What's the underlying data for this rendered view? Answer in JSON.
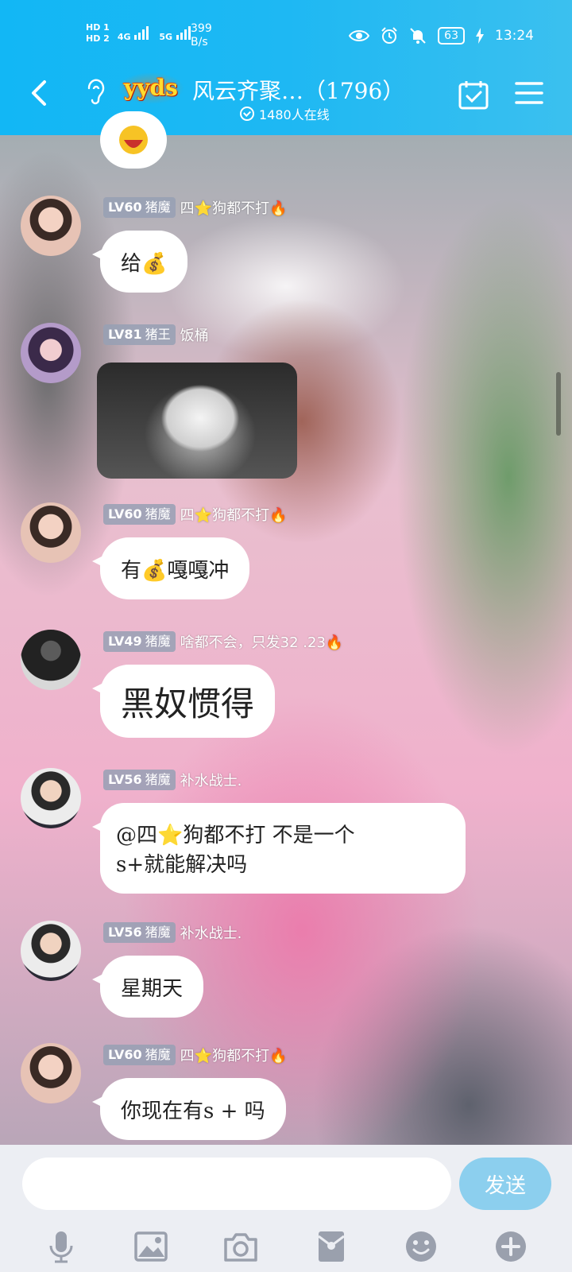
{
  "status_bar": {
    "sim1": "HD 1",
    "sim2": "HD 2",
    "net1": "4G",
    "net2": "5G",
    "speed_value": "399",
    "speed_unit": "B/s",
    "battery": "63",
    "time": "13:24"
  },
  "header": {
    "yyds_logo_text": "yyds",
    "group_name": "风云齐聚…（1796）",
    "online_count": "1480人在线"
  },
  "messages": [
    {
      "level": "LV60",
      "role": "猪魔",
      "nickname": "四⭐狗都不打🔥",
      "text": "给💰"
    },
    {
      "level": "LV81",
      "role": "猪王",
      "nickname": "饭桶",
      "image": "cat-photo"
    },
    {
      "level": "LV60",
      "role": "猪魔",
      "nickname": "四⭐狗都不打🔥",
      "text": "有💰嘎嘎冲"
    },
    {
      "level": "LV49",
      "role": "猪魔",
      "nickname": "啥都不会，只发32 .23🔥",
      "text": "黑奴惯得"
    },
    {
      "level": "LV56",
      "role": "猪魔",
      "nickname": "补水战士.",
      "text_line1": "@四⭐狗都不打 不是一个",
      "text_line2": "s+就能解决吗"
    },
    {
      "level": "LV56",
      "role": "猪魔",
      "nickname": "补水战士.",
      "text": "星期天"
    },
    {
      "level": "LV60",
      "role": "猪魔",
      "nickname": "四⭐狗都不打🔥",
      "text": "你现在有s + 吗"
    }
  ],
  "input": {
    "value": "",
    "send_label": "发送"
  },
  "colors": {
    "header_blue": "#12b7f5",
    "send_button": "#8ccfee",
    "toolbar_icon": "#9aa0ad"
  },
  "icons": {
    "toolbar": [
      "microphone-icon",
      "image-icon",
      "camera-icon",
      "red-packet-icon",
      "emoji-icon",
      "plus-icon"
    ]
  }
}
